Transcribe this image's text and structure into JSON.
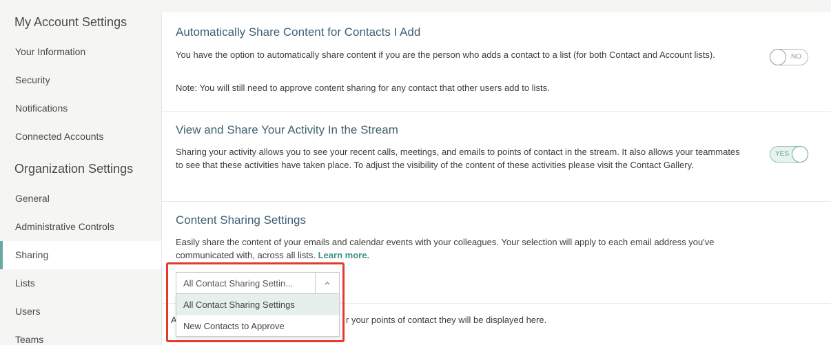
{
  "sidebar": {
    "my_account_heading": "My Account Settings",
    "my_account_items": [
      {
        "label": "Your Information"
      },
      {
        "label": "Security"
      },
      {
        "label": "Notifications"
      },
      {
        "label": "Connected Accounts"
      }
    ],
    "org_heading": "Organization Settings",
    "org_items": [
      {
        "label": "General"
      },
      {
        "label": "Administrative Controls"
      },
      {
        "label": "Sharing",
        "active": true
      },
      {
        "label": "Lists"
      },
      {
        "label": "Users"
      },
      {
        "label": "Teams"
      }
    ]
  },
  "auto_share": {
    "title": "Automatically Share Content for Contacts I Add",
    "description": "You have the option to automatically share content if you are the person who adds a contact to a list (for both Contact and Account lists).",
    "note": "Note: You will still need to approve content sharing for any contact that other users add to lists.",
    "toggle_label": "NO",
    "toggle_state": "off"
  },
  "activity": {
    "title": "View and Share Your Activity In the Stream",
    "description": "Sharing your activity allows you to see your recent calls, meetings, and emails to points of contact in the stream. It also allows your teammates to see that these activities have taken place. To adjust the visibility of the content of these activities please visit the Contact Gallery.",
    "toggle_label": "YES",
    "toggle_state": "on"
  },
  "content_sharing": {
    "title": "Content Sharing Settings",
    "description": "Easily share the content of your emails and calendar events with your colleagues. Your selection will apply to each email address you've communicated with, across all lists.",
    "learn_more": "Learn more.",
    "select_value": "All Contact Sharing Settin...",
    "options": [
      {
        "label": "All Contact Sharing Settings",
        "selected": true
      },
      {
        "label": "New Contacts to Approve",
        "selected": false
      }
    ],
    "empty_prefix": "A",
    "empty_suffix": "r your points of contact they will be displayed here."
  },
  "colors": {
    "accent": "#6aa9a0",
    "title": "#3f5f73",
    "highlight": "#e53a2b"
  }
}
